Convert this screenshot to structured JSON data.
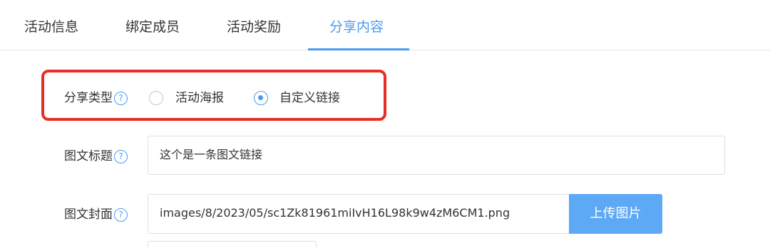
{
  "tabs": [
    {
      "label": "活动信息",
      "active": false
    },
    {
      "label": "绑定成员",
      "active": false
    },
    {
      "label": "活动奖励",
      "active": false
    },
    {
      "label": "分享内容",
      "active": true
    }
  ],
  "accent_color": "#4a9bf0",
  "highlight_color": "#ea2d24",
  "form": {
    "share_type": {
      "label": "分享类型",
      "help_icon": "question-circle-icon",
      "options": [
        {
          "label": "活动海报",
          "selected": false
        },
        {
          "label": "自定义链接",
          "selected": true
        }
      ]
    },
    "title": {
      "label": "图文标题",
      "help_icon": "question-circle-icon",
      "value": "这个是一条图文链接"
    },
    "cover": {
      "label": "图文封面",
      "help_icon": "question-circle-icon",
      "value": "images/8/2023/05/sc1Zk81961miIvH16L98k9w4zM6CM1.png",
      "upload_button": "上传图片"
    }
  }
}
